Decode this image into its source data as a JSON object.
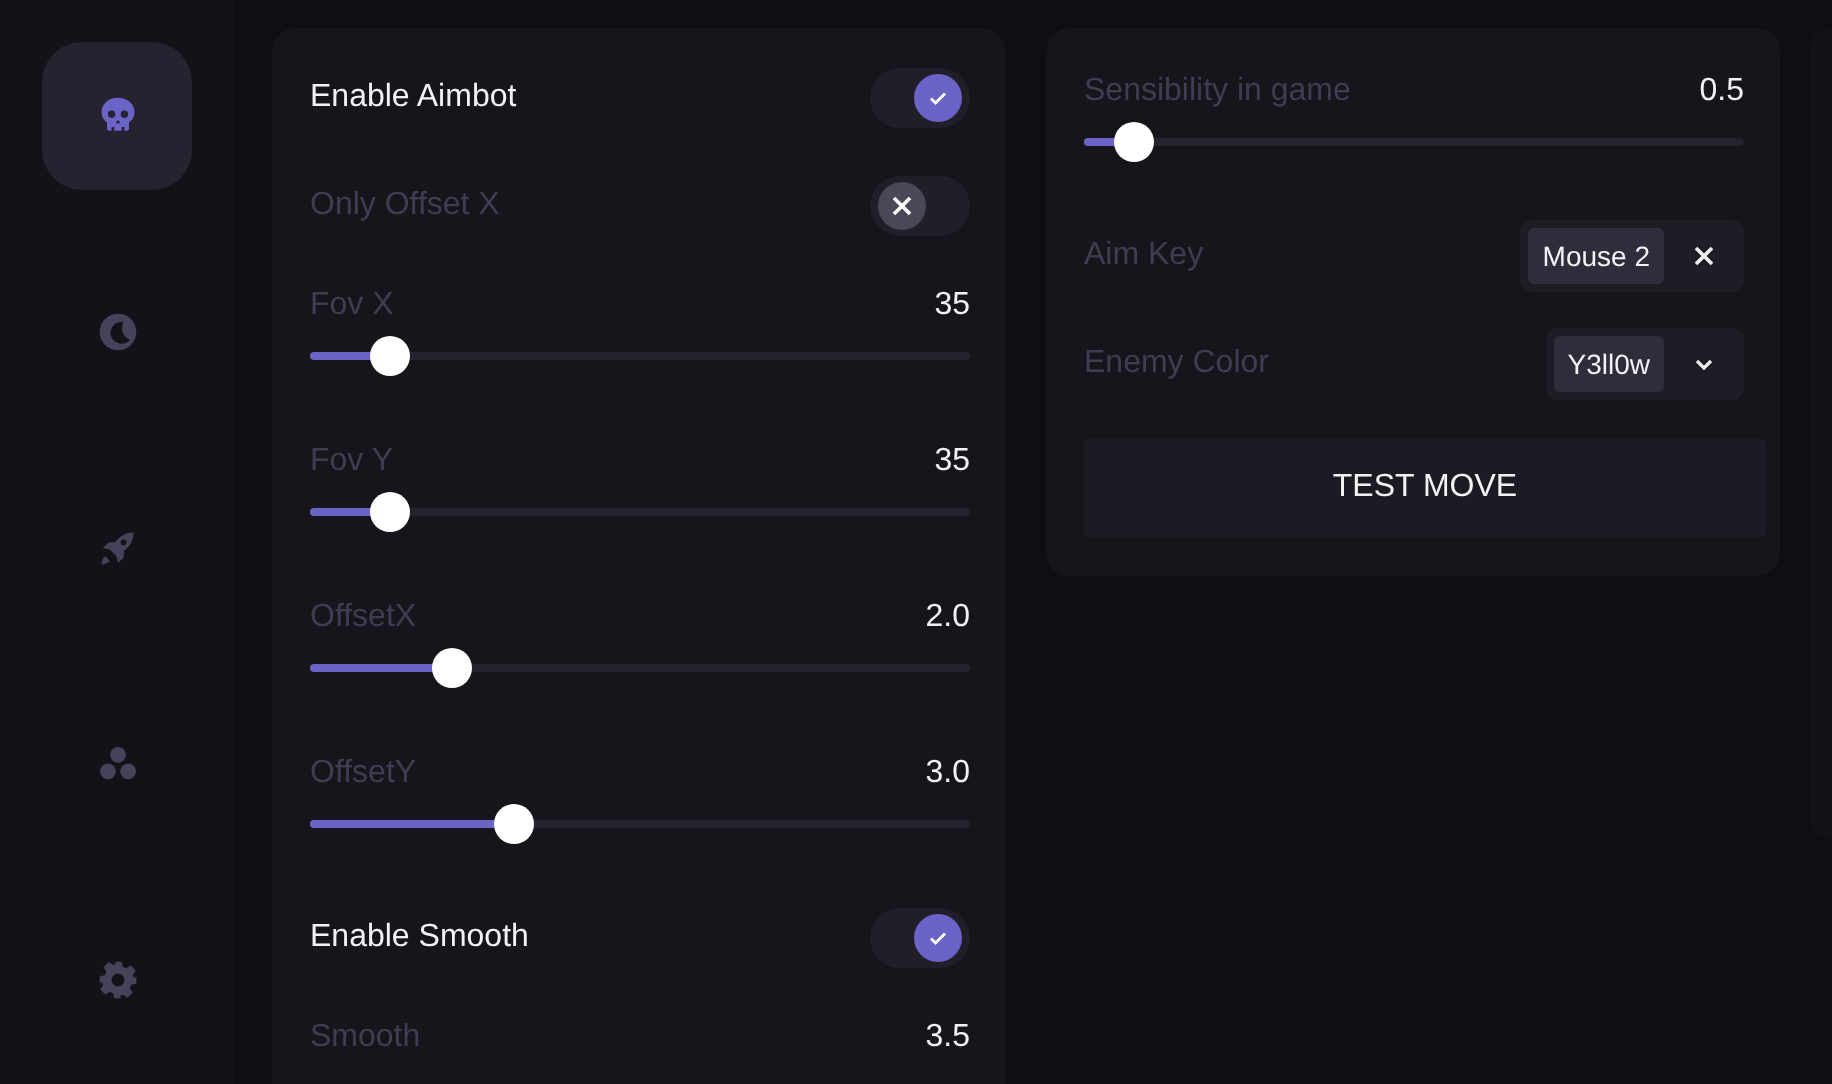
{
  "sidebar": {
    "items": [
      {
        "selected": true
      },
      {
        "selected": false
      },
      {
        "selected": false
      },
      {
        "selected": false
      },
      {
        "selected": false
      }
    ]
  },
  "left_panel": {
    "rows": [
      {
        "kind": "toggle",
        "label": "Enable Aimbot",
        "on": true
      },
      {
        "kind": "toggle",
        "label": "Only Offset X",
        "on": false
      },
      {
        "kind": "slider",
        "label": "Fov X",
        "reading": "35",
        "level": 0.12
      },
      {
        "kind": "slider",
        "label": "Fov Y",
        "reading": "35",
        "level": 0.12
      },
      {
        "kind": "slider",
        "label": "OffsetX",
        "reading": "2.0",
        "level": 0.215
      },
      {
        "kind": "slider",
        "label": "OffsetY",
        "reading": "3.0",
        "level": 0.31
      },
      {
        "kind": "toggle",
        "label": "Enable Smooth",
        "on": true
      },
      {
        "kind": "slider",
        "label": "Smooth",
        "reading": "3.5"
      }
    ]
  },
  "right_panel": {
    "rows": [
      {
        "kind": "slider",
        "label": "Sensibility in game",
        "reading": "0.5",
        "level": 0.075
      },
      {
        "kind": "key",
        "label": "Aim Key",
        "value": "Mouse 2"
      },
      {
        "kind": "select",
        "label": "Enemy Color",
        "value": "Y3ll0w"
      }
    ],
    "button": "TEST MOVE"
  }
}
